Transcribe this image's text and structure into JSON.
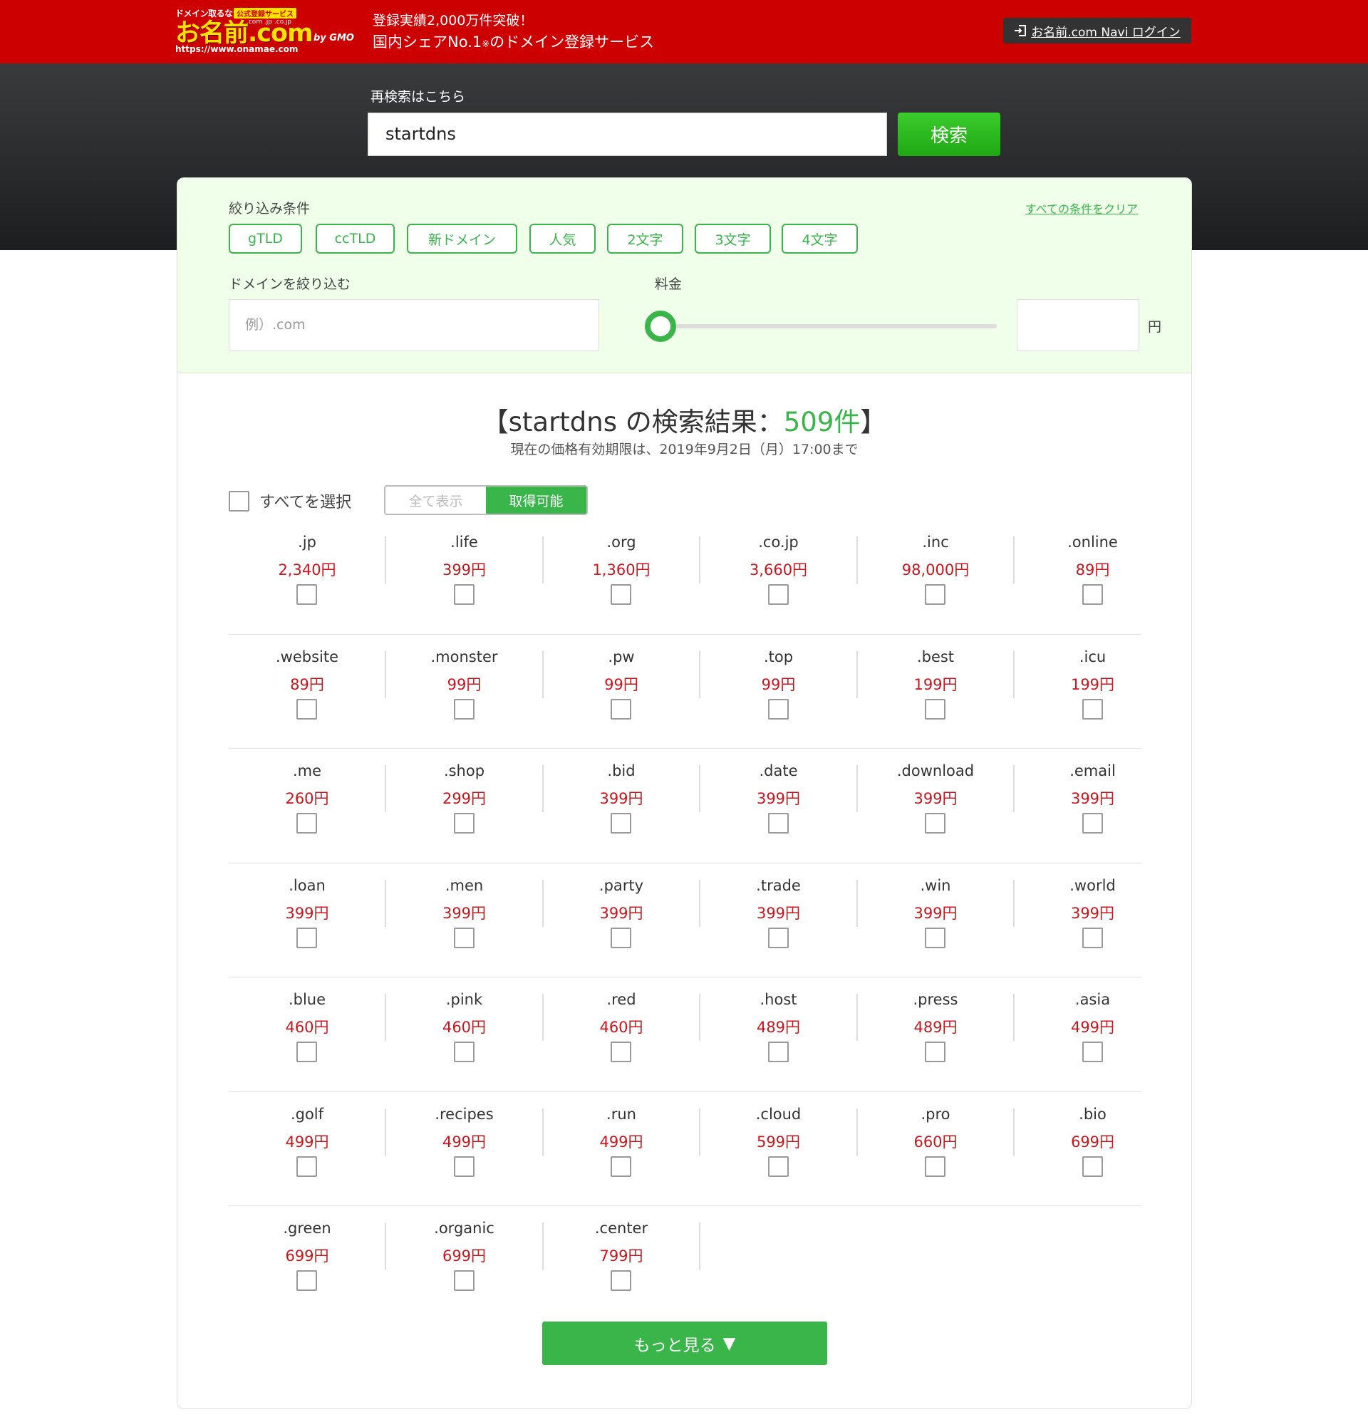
{
  "header": {
    "logo": {
      "tagline_small": "ドメイン取るなら",
      "badge": "公式登録サービス",
      "tlds": ".com .jp .co.jp",
      "name": "お名前.com",
      "by": "by GMO",
      "url": "https://www.onamae.com"
    },
    "tagline_line1": "登録実績2,000万件突破！",
    "tagline_line2_a": "国内シェアNo.1",
    "tagline_line2_mark": "※",
    "tagline_line2_b": "のドメイン登録サービス",
    "navi_login_label": "お名前.com Navi ログイン"
  },
  "search": {
    "label": "再検索はこちら",
    "value": "startdns",
    "button_label": "検索"
  },
  "filter": {
    "title": "絞り込み条件",
    "clear_label": "すべての条件をクリア",
    "chips": [
      "gTLD",
      "ccTLD",
      "新ドメイン",
      "人気",
      "2文字",
      "3文字",
      "4文字"
    ],
    "narrow_label": "ドメインを絞り込む",
    "narrow_placeholder": "例）.com",
    "price_label": "料金",
    "price_value": "",
    "yen_label": "円"
  },
  "results": {
    "heading_prefix": "【startdns の検索結果：",
    "count": "509件",
    "heading_suffix": "】",
    "validity": "現在の価格有効期限は、2019年9月2日（月）17:00まで",
    "select_all_label": "すべてを選択",
    "toggle_all_label": "全て表示",
    "toggle_available_label": "取得可能",
    "domains": [
      {
        "tld": ".jp",
        "price": "2,340円"
      },
      {
        "tld": ".life",
        "price": "399円"
      },
      {
        "tld": ".org",
        "price": "1,360円"
      },
      {
        "tld": ".co.jp",
        "price": "3,660円"
      },
      {
        "tld": ".inc",
        "price": "98,000円"
      },
      {
        "tld": ".online",
        "price": "89円"
      },
      {
        "tld": ".website",
        "price": "89円"
      },
      {
        "tld": ".monster",
        "price": "99円"
      },
      {
        "tld": ".pw",
        "price": "99円"
      },
      {
        "tld": ".top",
        "price": "99円"
      },
      {
        "tld": ".best",
        "price": "199円"
      },
      {
        "tld": ".icu",
        "price": "199円"
      },
      {
        "tld": ".me",
        "price": "260円"
      },
      {
        "tld": ".shop",
        "price": "299円"
      },
      {
        "tld": ".bid",
        "price": "399円"
      },
      {
        "tld": ".date",
        "price": "399円"
      },
      {
        "tld": ".download",
        "price": "399円"
      },
      {
        "tld": ".email",
        "price": "399円"
      },
      {
        "tld": ".loan",
        "price": "399円"
      },
      {
        "tld": ".men",
        "price": "399円"
      },
      {
        "tld": ".party",
        "price": "399円"
      },
      {
        "tld": ".trade",
        "price": "399円"
      },
      {
        "tld": ".win",
        "price": "399円"
      },
      {
        "tld": ".world",
        "price": "399円"
      },
      {
        "tld": ".blue",
        "price": "460円"
      },
      {
        "tld": ".pink",
        "price": "460円"
      },
      {
        "tld": ".red",
        "price": "460円"
      },
      {
        "tld": ".host",
        "price": "489円"
      },
      {
        "tld": ".press",
        "price": "489円"
      },
      {
        "tld": ".asia",
        "price": "499円"
      },
      {
        "tld": ".golf",
        "price": "499円"
      },
      {
        "tld": ".recipes",
        "price": "499円"
      },
      {
        "tld": ".run",
        "price": "499円"
      },
      {
        "tld": ".cloud",
        "price": "599円"
      },
      {
        "tld": ".pro",
        "price": "660円"
      },
      {
        "tld": ".bio",
        "price": "699円"
      },
      {
        "tld": ".green",
        "price": "699円"
      },
      {
        "tld": ".organic",
        "price": "699円"
      },
      {
        "tld": ".center",
        "price": "799円"
      }
    ],
    "more_label": "もっと見る",
    "more_arrow": "▼"
  },
  "colors": {
    "brand_red": "#cc0000",
    "accent_green": "#39b54a",
    "price_red": "#c8161d",
    "filter_bg": "#efffea"
  },
  "icons": {
    "login": "login-icon",
    "more": "triangle-down-icon"
  }
}
